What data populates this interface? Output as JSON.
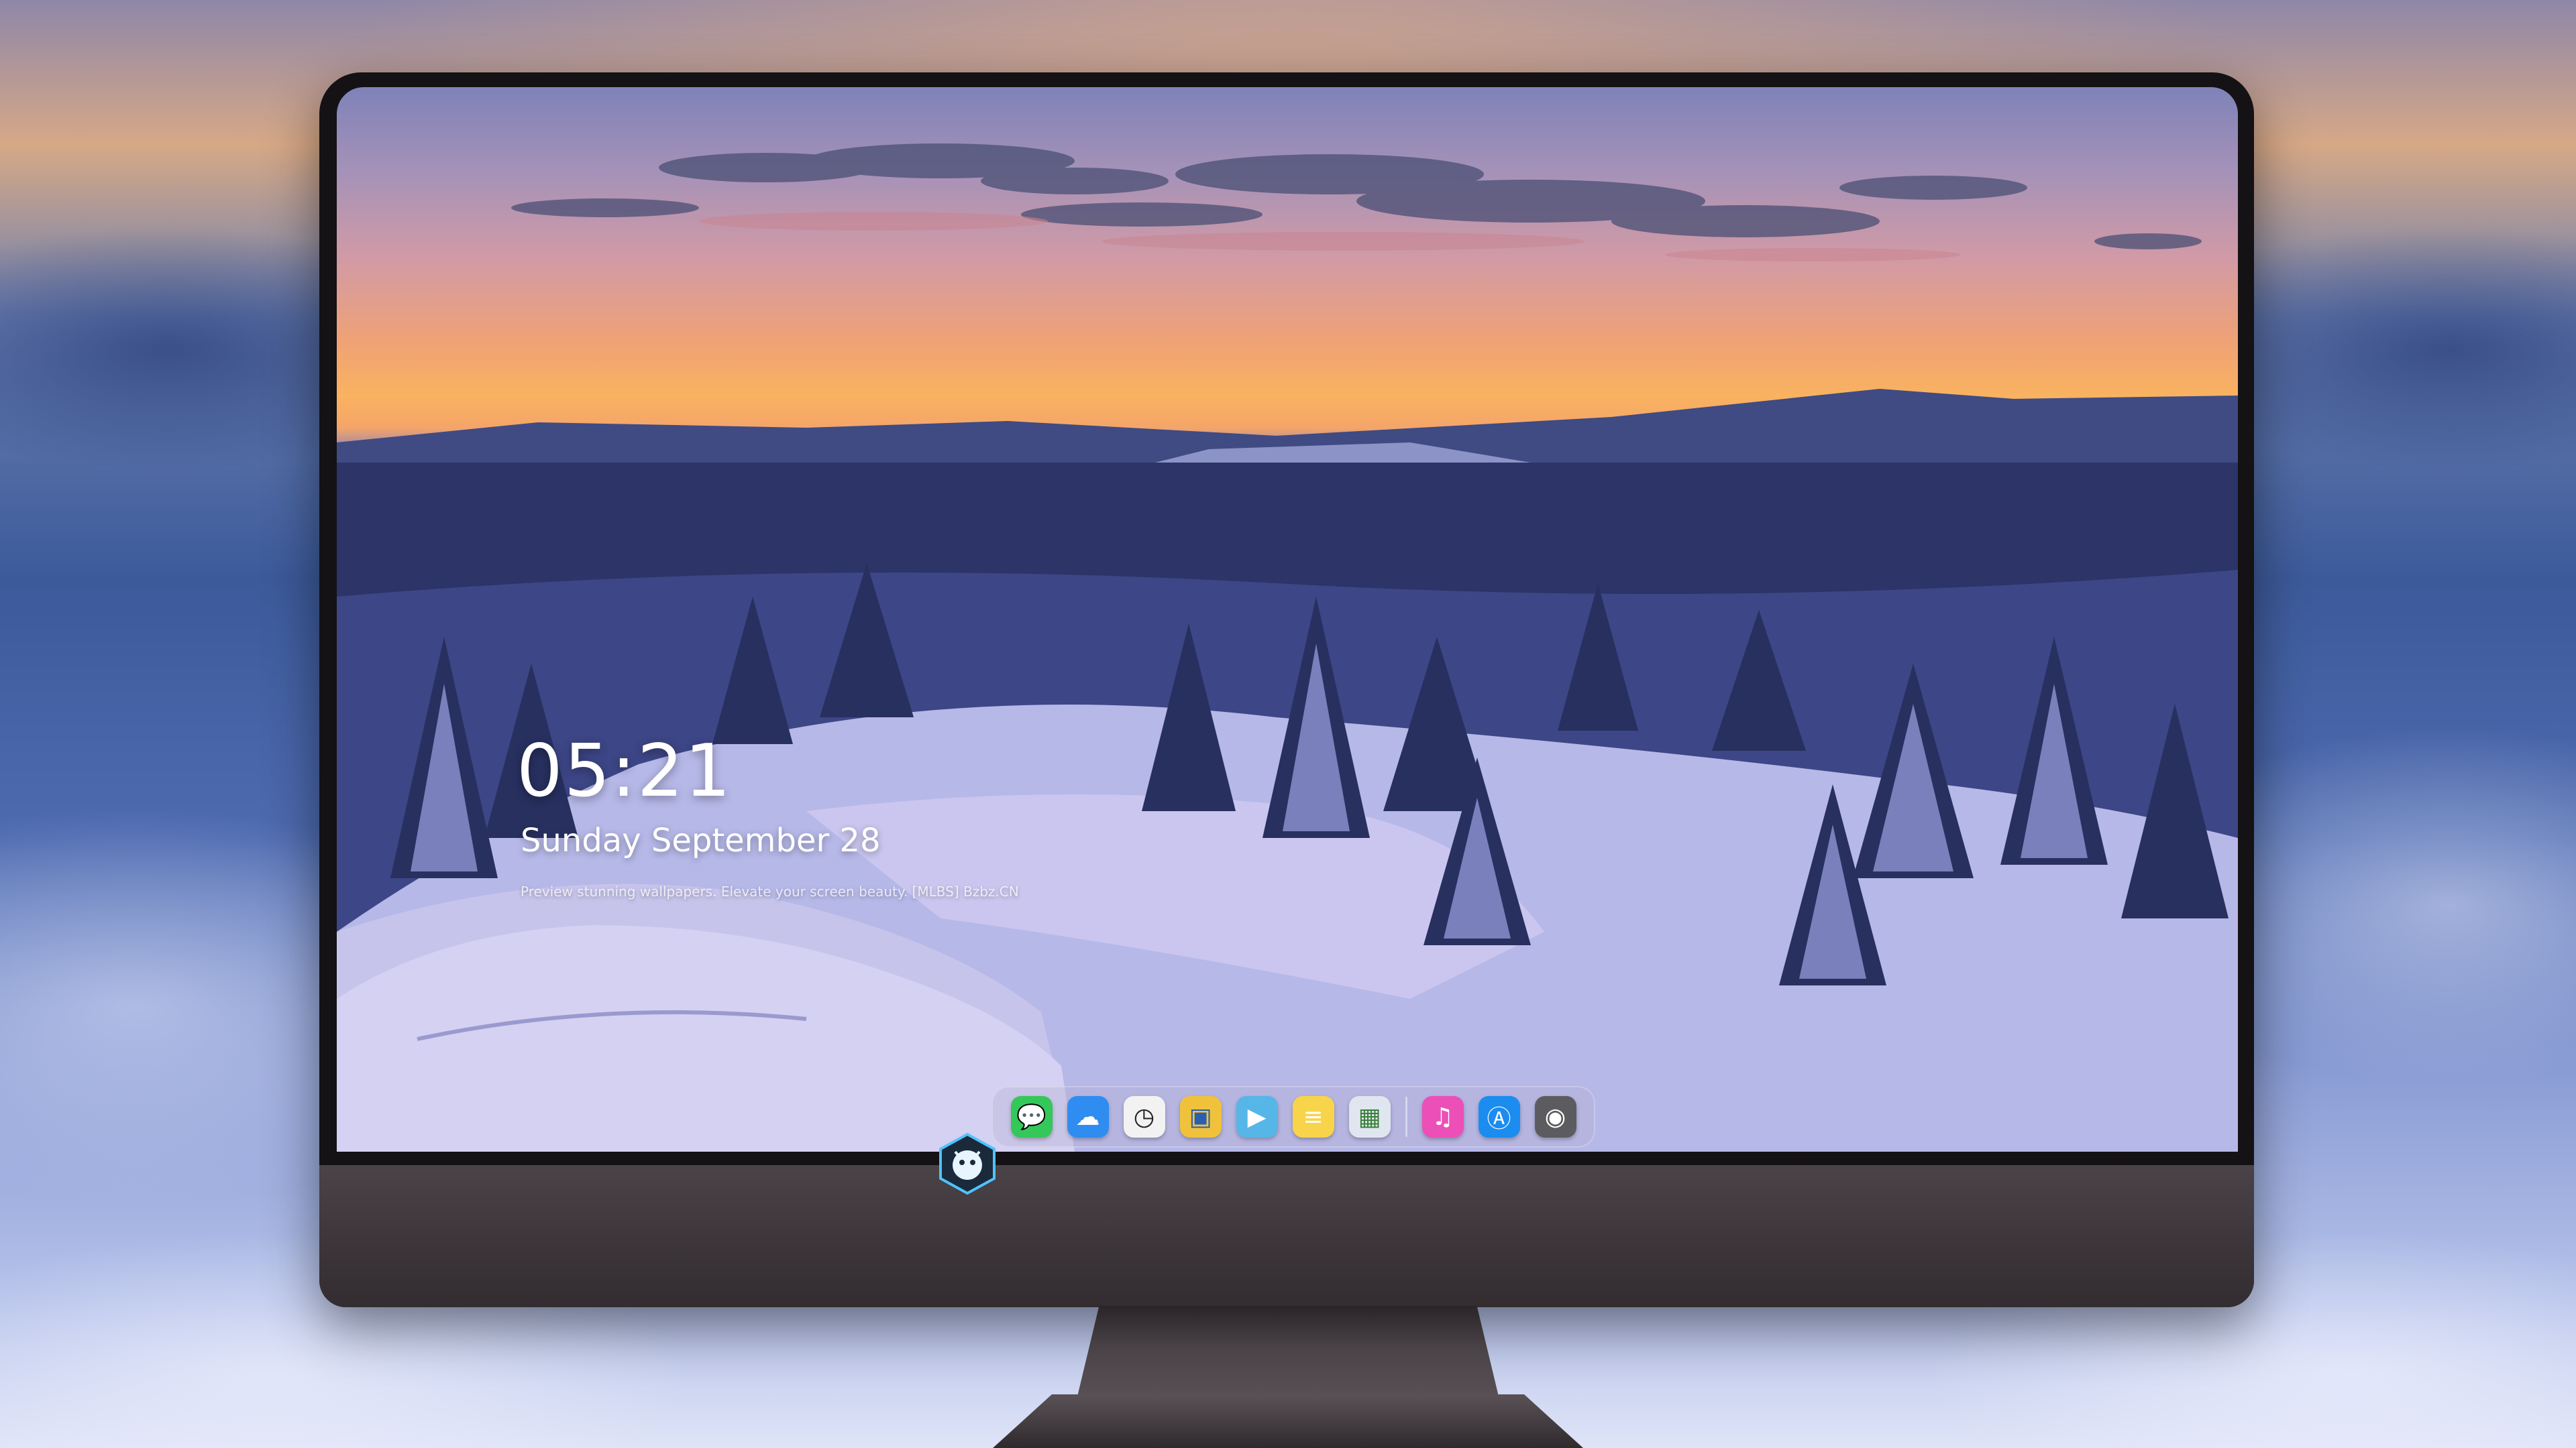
{
  "lockscreen": {
    "time": "05:21",
    "date": "Sunday September 28",
    "tagline": "Preview stunning wallpapers. Elevate your screen beauty. [MLBS] Bzbz.CN"
  },
  "dock": {
    "apps": [
      {
        "icon": "messages-icon",
        "glyph": "💬",
        "color": "#34c759"
      },
      {
        "icon": "weather-icon",
        "glyph": "☁",
        "color": "#2f8cf0"
      },
      {
        "icon": "clock-icon",
        "glyph": "🕐",
        "color": "#f2f2f2"
      },
      {
        "icon": "preview-icon",
        "glyph": "🖼",
        "color": "#f0c23c"
      },
      {
        "icon": "clips-icon",
        "glyph": "🎬",
        "color": "#56b6e8"
      },
      {
        "icon": "notes-icon",
        "glyph": "≡",
        "color": "#f7d44a"
      },
      {
        "icon": "photo-browser-icon",
        "glyph": "▦",
        "color": "#e0e6ef"
      },
      {
        "icon": "music-icon",
        "glyph": "♫",
        "color": "#ec4fb8"
      },
      {
        "icon": "app-store-icon",
        "glyph": "A",
        "color": "#1b8cf0"
      },
      {
        "icon": "camera-icon",
        "glyph": "◉",
        "color": "#5c5c60"
      }
    ]
  },
  "colors": {
    "bezel": "#141214",
    "chin": "#3b3438",
    "sky_top": "#7f82b8",
    "sky_glow": "#f9b260",
    "snow": "#dcdbf3"
  }
}
